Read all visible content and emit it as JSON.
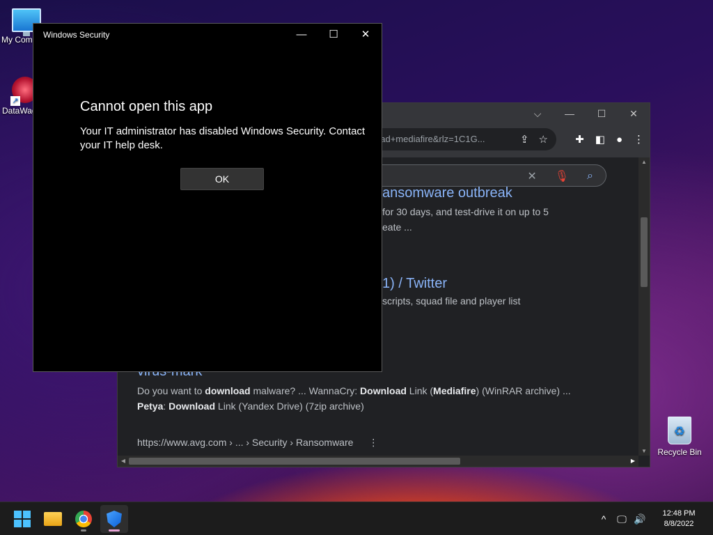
{
  "desktop": {
    "icons": [
      {
        "label": "My Com"
      },
      {
        "label": "DataWag"
      },
      {
        "label": "Recycle Bin"
      }
    ]
  },
  "browser": {
    "controls": {
      "dropdown": "⌵",
      "minimize": "—",
      "maximize": "☐",
      "close": "✕"
    },
    "address_visible": "oad+mediafire&rlz=1C1G...",
    "search_clear": "✕",
    "results": {
      "link1_partial": "ansomware outbreak",
      "text1_line1": "for 30 days, and test-drive it on up to 5",
      "text1_line2": "eate ...",
      "link2_partial": "1) / Twitter",
      "text2": "scripts, squad file and player list",
      "link3_partial": "virus-mark",
      "snippet_line1": [
        {
          "t": "Do you want to ",
          "b": false
        },
        {
          "t": "download",
          "b": true
        },
        {
          "t": " malware? ... WannaCry: ",
          "b": false
        },
        {
          "t": "Download",
          "b": true
        },
        {
          "t": " Link (",
          "b": false
        },
        {
          "t": "Mediafire",
          "b": true
        },
        {
          "t": ") (WinRAR archive) ...",
          "b": false
        }
      ],
      "snippet_line2": [
        {
          "t": "Petya",
          "b": true
        },
        {
          "t": ": ",
          "b": false
        },
        {
          "t": "Download",
          "b": true
        },
        {
          "t": " Link (Yandex Drive) (7zip archive)",
          "b": false
        }
      ],
      "breadcrumb": "https://www.avg.com › ... › Security › Ransomware",
      "more": "⋮"
    }
  },
  "security_window": {
    "title": "Windows Security",
    "controls": {
      "minimize": "—",
      "maximize": "☐",
      "close": "✕"
    },
    "heading": "Cannot open this app",
    "message": "Your IT administrator has disabled Windows Security. Contact your IT help desk.",
    "ok_label": "OK"
  },
  "taskbar": {
    "tray": {
      "chevron": "^",
      "network": "🖵",
      "volume": "🔊"
    },
    "time": "12:48 PM",
    "date": "8/8/2022"
  },
  "colors": {
    "accent_link": "#8ab4f8",
    "taskbar": "#1c1c1c",
    "dialog_bg": "#000000"
  }
}
